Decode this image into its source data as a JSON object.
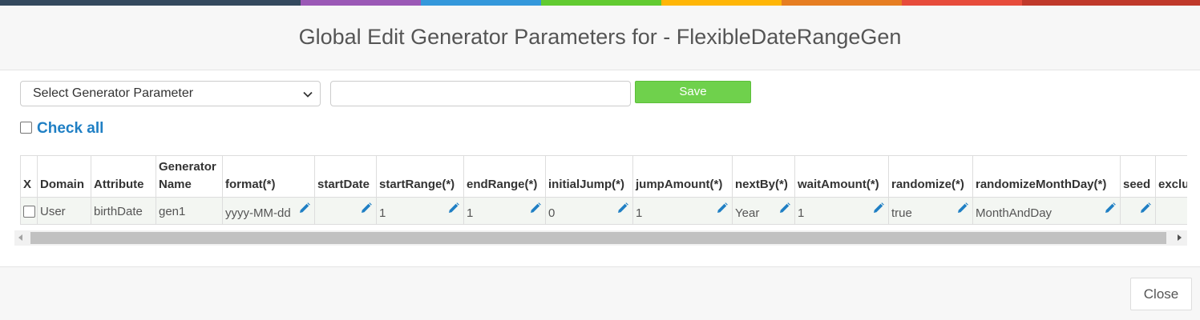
{
  "colors": {
    "stripe": [
      "#34495e",
      "#9b59b6",
      "#3498db",
      "#62cb31",
      "#ffb606",
      "#e67e22",
      "#e74c3c",
      "#c0392b"
    ],
    "save_button": "#6fd14c",
    "link_blue": "#1f7fc4"
  },
  "header": {
    "title": "Global Edit Generator Parameters for - FlexibleDateRangeGen"
  },
  "controls": {
    "select": {
      "selected": "Select Generator Parameter"
    },
    "input": {
      "value": "",
      "placeholder": ""
    },
    "save_label": "Save",
    "check_all_label": "Check all"
  },
  "table": {
    "columns": [
      "X",
      "Domain",
      "Attribute",
      "Generator Name",
      "format(*)",
      "startDate",
      "startRange(*)",
      "endRange(*)",
      "initialJump(*)",
      "jumpAmount(*)",
      "nextBy(*)",
      "waitAmount(*)",
      "randomize(*)",
      "randomizeMonthDay(*)",
      "seed",
      "exclu"
    ],
    "row": {
      "domain": "User",
      "attribute": "birthDate",
      "generator_name": "gen1",
      "format": "yyyy-MM-dd",
      "startDate": "",
      "startRange": "1",
      "endRange": "1",
      "initialJump": "0",
      "jumpAmount": "1",
      "nextBy": "Year",
      "waitAmount": "1",
      "randomize": "true",
      "randomizeMonthDay": "MonthAndDay",
      "seed": "",
      "exclu": ""
    },
    "edit_icon": "pencil-icon"
  },
  "footer": {
    "close_label": "Close"
  }
}
